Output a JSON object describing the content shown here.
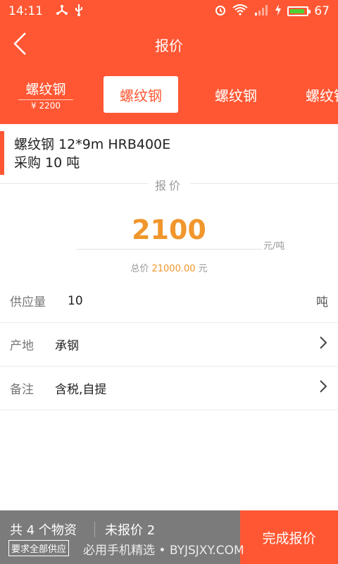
{
  "status": {
    "time": "14:11",
    "battery": "67"
  },
  "header": {
    "title": "报价"
  },
  "tabs": [
    {
      "label": "螺纹钢",
      "sub": "¥ 2200"
    },
    {
      "label": "螺纹钢"
    },
    {
      "label": "螺纹钢"
    },
    {
      "label": "螺纹钢"
    }
  ],
  "product": {
    "spec": "螺纹钢 12*9m HRB400E",
    "purchase": "采购 10 吨"
  },
  "quote": {
    "section_label": "报价",
    "price": "2100",
    "unit": "元/吨",
    "total_prefix": "总价",
    "total_amount": "21000.00",
    "total_unit": "元"
  },
  "fields": [
    {
      "label": "供应量",
      "value": "10",
      "tail": "吨"
    },
    {
      "label": "产地",
      "value": "承钢"
    },
    {
      "label": "备注",
      "value": "含税,自提"
    }
  ],
  "bottom": {
    "count_text": "共 4 个物资",
    "unquoted_text": "未报价  2",
    "ask_all": "要求全部供应",
    "complete": "完成报价"
  },
  "watermark": "必用手机精选 • BYJSJXY.COM",
  "colors": {
    "accent": "#ff5733",
    "price": "#f0962c",
    "bottom_gray": "#7b7b7b"
  }
}
